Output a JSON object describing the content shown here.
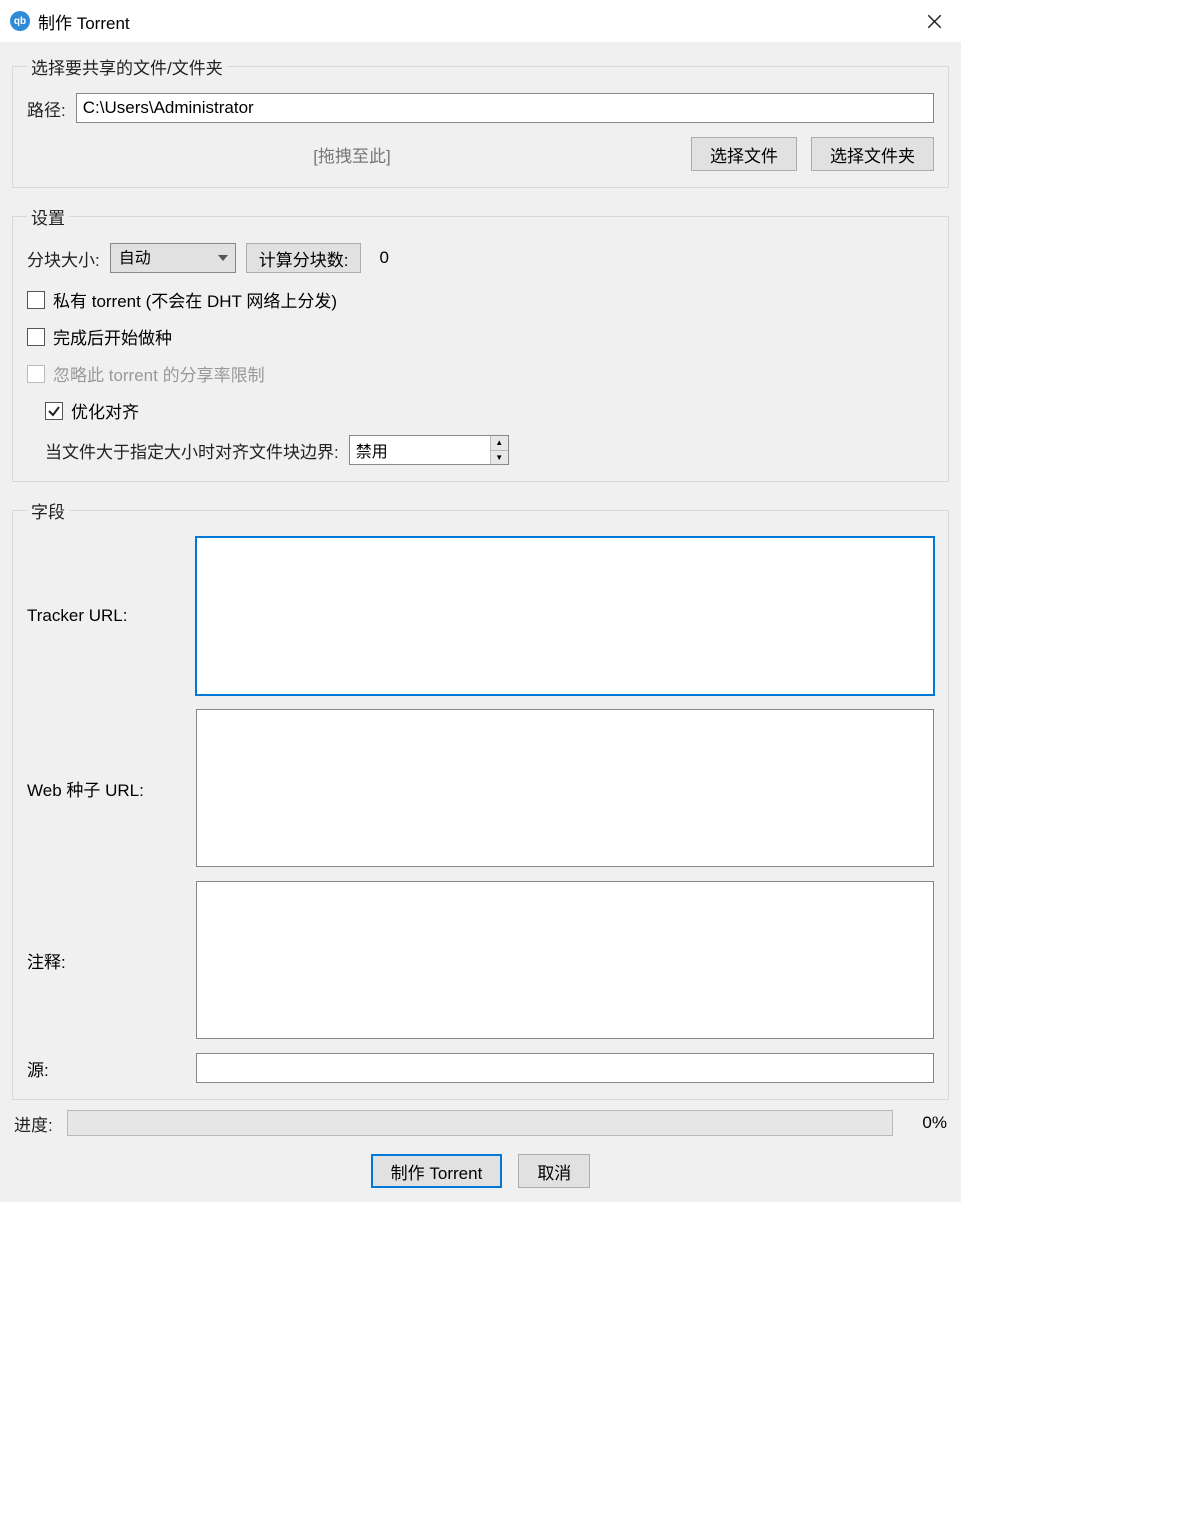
{
  "window": {
    "title": "制作 Torrent"
  },
  "file_group": {
    "legend": "选择要共享的文件/文件夹",
    "path_label": "路径:",
    "path_value": "C:\\Users\\Administrator",
    "drag_hint": "[拖拽至此]",
    "select_file": "选择文件",
    "select_folder": "选择文件夹"
  },
  "settings_group": {
    "legend": "设置",
    "piece_size_label": "分块大小:",
    "piece_size_value": "自动",
    "calc_pieces": "计算分块数:",
    "piece_count": "0",
    "private_label": "私有 torrent  (不会在 DHT 网络上分发)",
    "start_seeding_label": "完成后开始做种",
    "ignore_ratio_label": "忽略此 torrent 的分享率限制",
    "optimize_align_label": "优化对齐",
    "align_boundary_label": "当文件大于指定大小时对齐文件块边界:",
    "align_boundary_value": "禁用"
  },
  "fields_group": {
    "legend": "字段",
    "tracker_url_label": "Tracker URL:",
    "web_seed_label": "Web 种子 URL:",
    "comment_label": "注释:",
    "source_label": "源:"
  },
  "progress": {
    "label": "进度:",
    "percent": "0%"
  },
  "buttons": {
    "create": "制作 Torrent",
    "cancel": "取消"
  }
}
